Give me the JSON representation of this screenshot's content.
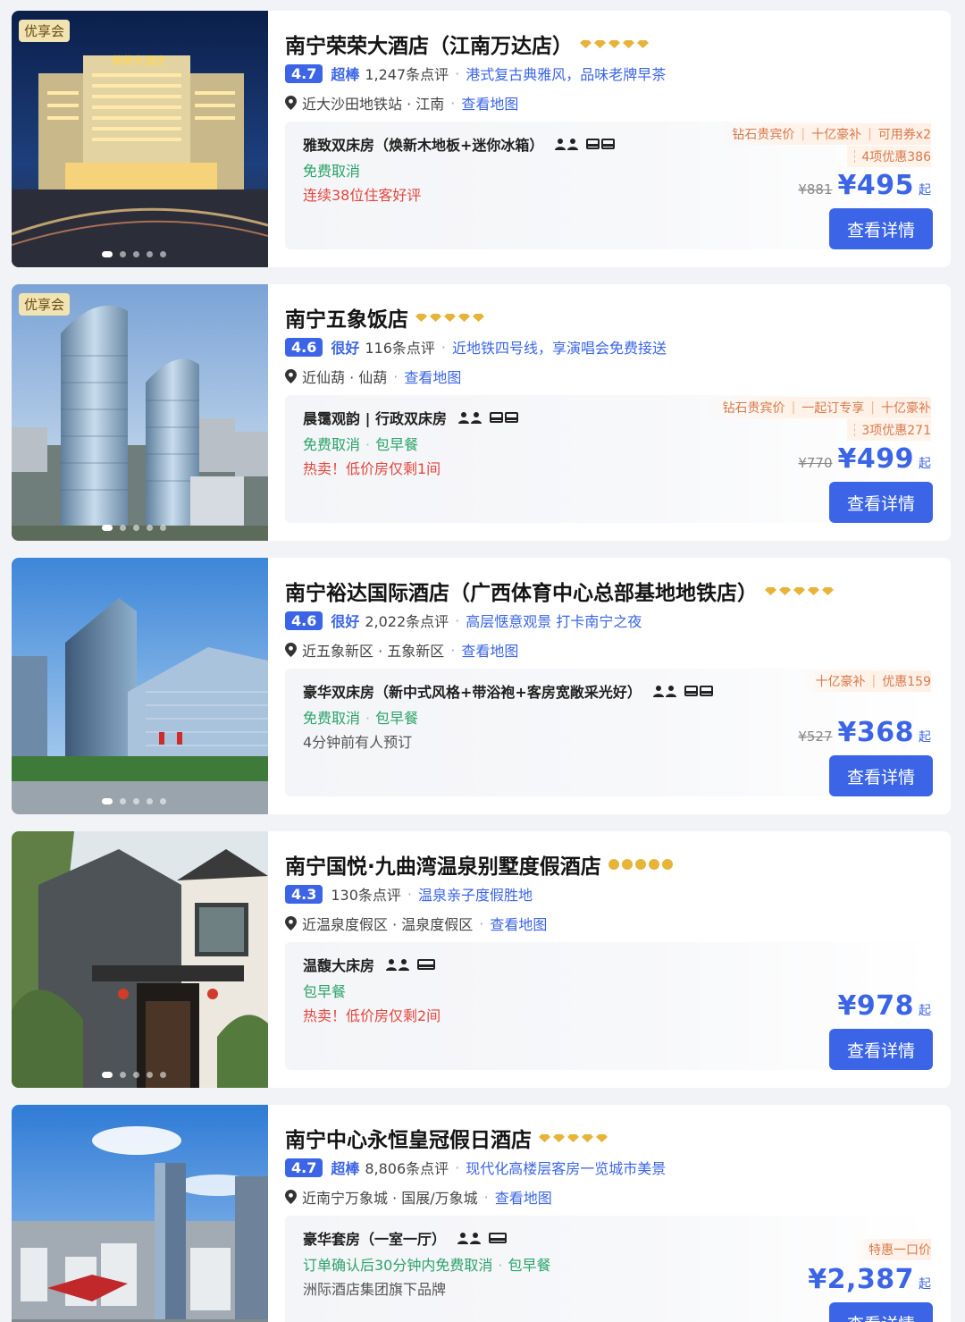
{
  "common": {
    "detail_button": "查看详情",
    "map_link": "查看地图",
    "price_suffix": "起",
    "badge_vip": "优享会"
  },
  "hotels": [
    {
      "name": "南宁荣荣大酒店（江南万达店）",
      "score": "4.7",
      "grade": "超棒",
      "reviews": "1,247条点评",
      "tagline": "港式复古典雅风，品味老牌早茶",
      "location": "近大沙田地铁站 · 江南",
      "room": "雅致双床房（焕新木地板+迷你冰箱）",
      "perks": [
        "免费取消"
      ],
      "note": "连续38位住客好评",
      "promos": [
        "钻石贵宾价",
        "十亿豪补",
        "可用券x2"
      ],
      "promo_extra": "4项优惠386",
      "original_price": "¥881",
      "price": "¥495",
      "sign_text": "荣荣大酒店"
    },
    {
      "name": "南宁五象饭店",
      "score": "4.6",
      "grade": "很好",
      "reviews": "116条点评",
      "tagline": "近地铁四号线，享演唱会免费接送",
      "location": "近仙葫 · 仙葫",
      "room": "晨霭观韵 | 行政双床房",
      "perks": [
        "免费取消",
        "包早餐"
      ],
      "note": "热卖！低价房仅剩1间",
      "promos": [
        "钻石贵宾价",
        "一起订专享",
        "十亿豪补"
      ],
      "promo_extra": "3项优惠271",
      "original_price": "¥770",
      "price": "¥499"
    },
    {
      "name": "南宁裕达国际酒店（广西体育中心总部基地地铁店）",
      "score": "4.6",
      "grade": "很好",
      "reviews": "2,022条点评",
      "tagline": "高层惬意观景 打卡南宁之夜",
      "location": "近五象新区 · 五象新区",
      "room": "豪华双床房（新中式风格+带浴袍+客房宽敞采光好）",
      "perks": [
        "免费取消",
        "包早餐"
      ],
      "note": "4分钟前有人预订",
      "promos": [
        "十亿豪补",
        "优惠159"
      ],
      "original_price": "¥527",
      "price": "¥368"
    },
    {
      "name": "南宁国悦·九曲湾温泉别墅度假酒店",
      "score": "4.3",
      "reviews": "130条点评",
      "tagline": "温泉亲子度假胜地",
      "location": "近温泉度假区 · 温泉度假区",
      "room": "温馥大床房",
      "perks": [
        "包早餐"
      ],
      "note": "热卖！低价房仅剩2间",
      "price": "¥978"
    },
    {
      "name": "南宁中心永恒皇冠假日酒店",
      "score": "4.7",
      "grade": "超棒",
      "reviews": "8,806条点评",
      "tagline": "现代化高楼层客房一览城市美景",
      "location": "近南宁万象城 · 国展/万象城",
      "room": "豪华套房（一室一厅）",
      "perks": [
        "订单确认后30分钟内免费取消",
        "包早餐"
      ],
      "note": "洲际酒店集团旗下品牌",
      "promos": [
        "特惠一口价"
      ],
      "price": "¥2,387"
    }
  ],
  "colors": {
    "accent": "#3b65e6",
    "green": "#2ba36a",
    "red": "#e4463d",
    "promo": "#d87a4c",
    "diamond": "#e7b43a"
  }
}
